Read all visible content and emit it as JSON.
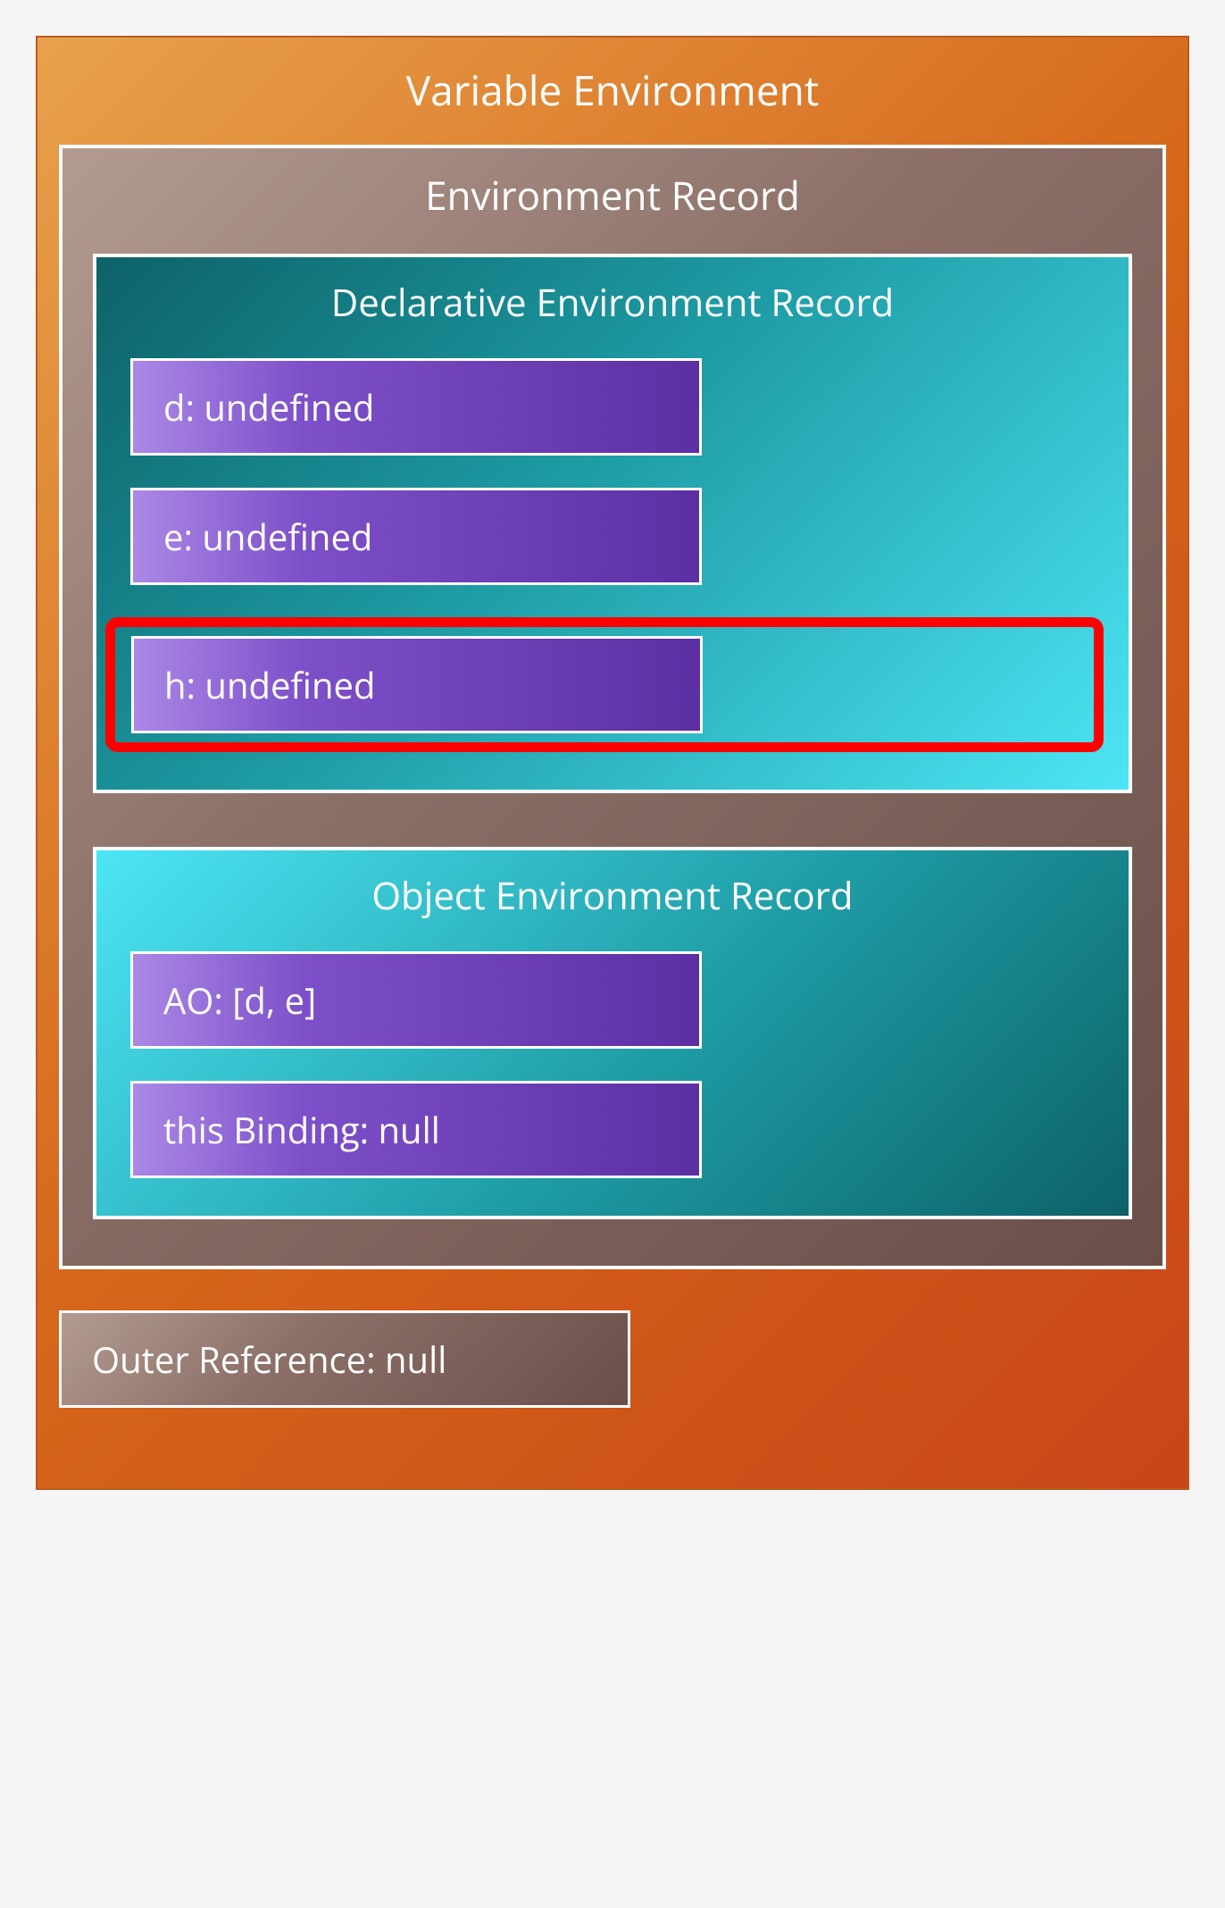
{
  "variableEnvironment": {
    "title": "Variable Environment",
    "environmentRecord": {
      "title": "Environment Record",
      "declarative": {
        "title": "Declarative Environment Record",
        "items": [
          {
            "text": "d: undefined",
            "highlighted": false
          },
          {
            "text": "e: undefined",
            "highlighted": false
          },
          {
            "text": "h: undefined",
            "highlighted": true
          }
        ]
      },
      "object": {
        "title": "Object Environment Record",
        "items": [
          {
            "text": "AO: [d, e]"
          },
          {
            "text": "this Binding: null"
          }
        ]
      }
    },
    "outerReference": "Outer Reference: null"
  }
}
